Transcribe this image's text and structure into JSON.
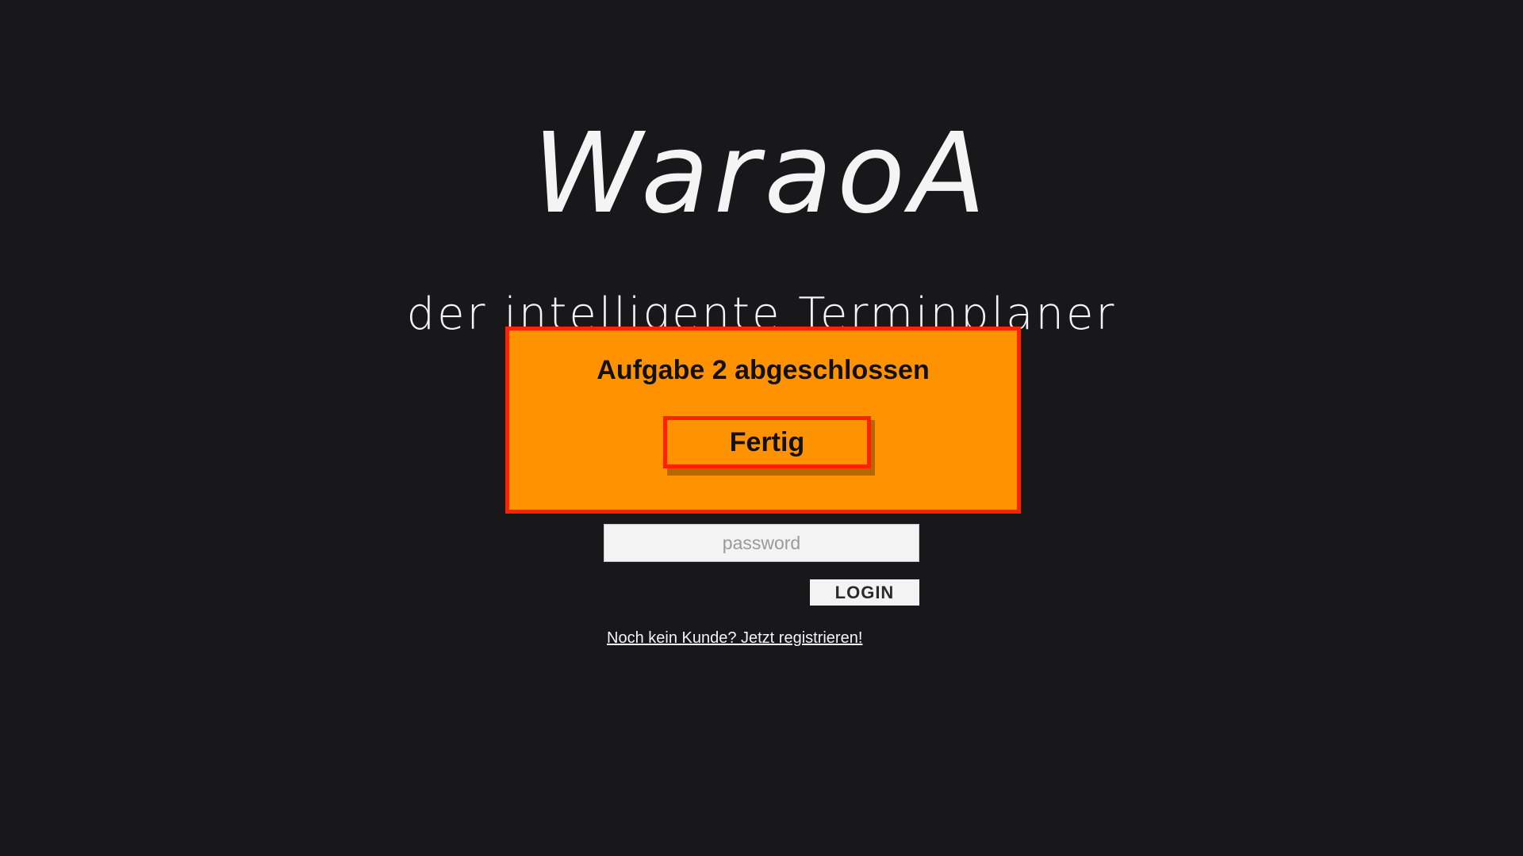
{
  "brand": {
    "logo_text": "WaraoA",
    "tagline": "der intelligente Terminplaner"
  },
  "login_form": {
    "password_placeholder": "password",
    "login_label": "LOGIN",
    "register_link": "Noch kein Kunde? Jetzt registrieren!"
  },
  "overlay": {
    "title": "Aufgabe 2 abgeschlossen",
    "done_label": "Fertig",
    "colors": {
      "background": "#ff9200",
      "border": "#ff2200"
    }
  },
  "theme": {
    "page_background": "#18181a",
    "text_color": "#f4f4f4",
    "input_background": "#f2f3f2"
  }
}
